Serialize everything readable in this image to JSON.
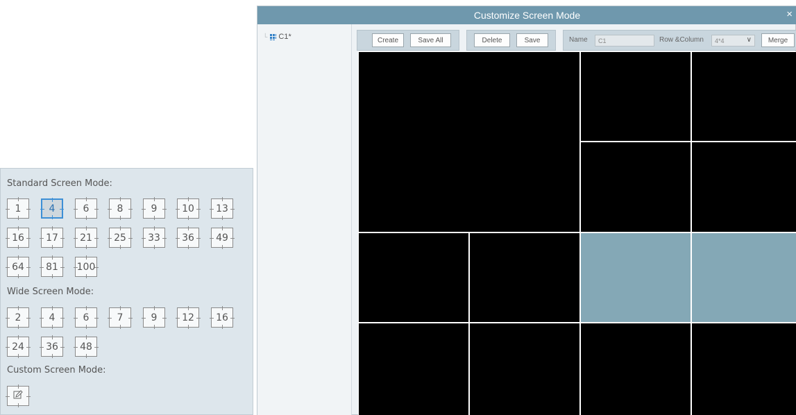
{
  "left_panel": {
    "standard_title": "Standard Screen Mode:",
    "standard_modes": [
      "1",
      "4",
      "6",
      "8",
      "9",
      "10",
      "13",
      "16",
      "17",
      "21",
      "25",
      "33",
      "36",
      "49",
      "64",
      "81",
      "100"
    ],
    "selected_mode": "4",
    "wide_title": "Wide Screen Mode:",
    "wide_modes": [
      "2",
      "4",
      "6",
      "7",
      "9",
      "12",
      "16",
      "24",
      "36",
      "48"
    ],
    "custom_title": "Custom Screen Mode:",
    "custom_icon": "edit-icon"
  },
  "dialog": {
    "title": "Customize Screen Mode",
    "close_symbol": "×",
    "tree_item": "C1*",
    "toolbar": {
      "create_label": "Create",
      "save_all_label": "Save All",
      "delete_label": "Delete",
      "save_label": "Save",
      "name_label": "Name",
      "name_value": "C1",
      "row_column_label": "Row &Column",
      "row_column_value": "4*4",
      "merge_label": "Merge"
    }
  },
  "grid": {
    "rows": 4,
    "columns": 4,
    "merged_region": "rows 1-2, columns 1-2",
    "selected_cells": [
      "row 3 column 3",
      "row 3 column 4"
    ],
    "cell_color": "#000000",
    "selected_color": "#84a8b6"
  },
  "colors": {
    "titlebar": "#6f98ad",
    "panel_bg": "#dde6ec",
    "selection_border": "#3d8fd6"
  }
}
